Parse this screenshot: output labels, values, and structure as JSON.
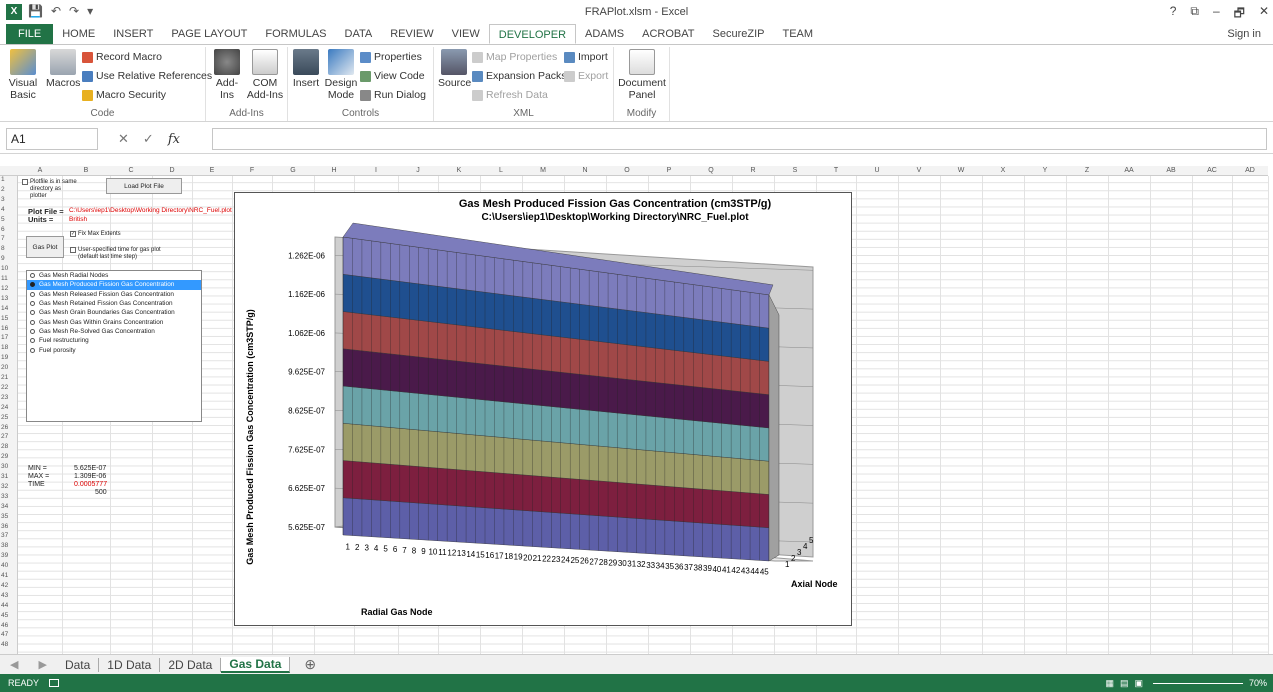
{
  "window": {
    "title": "FRAPlot.xlsm - Excel",
    "app_icon": "excel-icon",
    "controls": [
      "?",
      "⧉",
      "–",
      "🗗",
      "✕"
    ]
  },
  "ribbon_tabs": [
    "FILE",
    "HOME",
    "INSERT",
    "PAGE LAYOUT",
    "FORMULAS",
    "DATA",
    "REVIEW",
    "VIEW",
    "DEVELOPER",
    "ADAMS",
    "ACROBAT",
    "SecureZIP",
    "TEAM"
  ],
  "active_tab": "DEVELOPER",
  "sign_in": "Sign in",
  "ribbon": {
    "code": {
      "label": "Code",
      "visual_basic": "Visual Basic",
      "macros": "Macros",
      "record_macro": "Record Macro",
      "relative_refs": "Use Relative References",
      "macro_security": "Macro Security"
    },
    "addins": {
      "label": "Add-Ins",
      "addins": "Add-Ins",
      "com_addins": "COM Add-Ins"
    },
    "controls": {
      "label": "Controls",
      "insert": "Insert",
      "design_mode": "Design Mode",
      "properties": "Properties",
      "view_code": "View Code",
      "run_dialog": "Run Dialog"
    },
    "xml": {
      "label": "XML",
      "source": "Source",
      "map_properties": "Map Properties",
      "expansion_packs": "Expansion Packs",
      "refresh_data": "Refresh Data",
      "import": "Import",
      "export": "Export"
    },
    "modify": {
      "label": "Modify",
      "document_panel": "Document Panel"
    }
  },
  "namebox": "A1",
  "fx": "fx",
  "columns": [
    "A",
    "B",
    "C",
    "D",
    "E",
    "F",
    "G",
    "H",
    "I",
    "J",
    "K",
    "L",
    "M",
    "N",
    "O",
    "P",
    "Q",
    "R",
    "S",
    "T",
    "U",
    "V",
    "W",
    "X",
    "Y",
    "Z",
    "AA",
    "AB",
    "AC",
    "AD"
  ],
  "sheet": {
    "plotfile_checkbox": "Plotfile is in same directory as plotter",
    "load_button": "Load Plot File",
    "plot_file_label": "Plot File =",
    "plot_file_value": "C:\\Users\\iep1\\Desktop\\Working Directory\\NRC_Fuel.plot",
    "units_label": "Units =",
    "units_value": "British",
    "gas_plot_button": "Gas Plot",
    "fix_max_extents": "Fix Max Extents",
    "user_time": "User-specified time for gas plot (default last time step)",
    "options": [
      "Gas Mesh Radial Nodes",
      "Gas Mesh Produced Fission Gas Concentration",
      "Gas Mesh Released Fission Gas Concentration",
      "Gas Mesh Retained Fission Gas Concentration",
      "Gas Mesh Grain Boundaries Gas Concentration",
      "Gas Mesh Gas Within Grains Concentration",
      "Gas Mesh Re-Solved Gas Concentration",
      "Fuel restructuring",
      "Fuel porosity"
    ],
    "selected_option": 1,
    "min_label": "MIN =",
    "min_value": "5.625E-07",
    "max_label": "MAX =",
    "max_value": "1.309E-06",
    "time_label": "TIME",
    "time_value": "0.0005777",
    "row33_value": "500"
  },
  "chart_data": {
    "type": "surface",
    "title": "Gas Mesh Produced Fission Gas Concentration (cm3STP/g)",
    "subtitle": "C:\\Users\\iep1\\Desktop\\Working Directory\\NRC_Fuel.plot",
    "zlabel": "Gas Mesh Produced Fission Gas Concentration (cm3STP/g)",
    "xlabel": "Radial Gas Node",
    "ylabel": "Axial Node",
    "z_ticks": [
      "5.625E-07",
      "6.625E-07",
      "7.625E-07",
      "8.625E-07",
      "9.625E-07",
      "1.062E-06",
      "1.162E-06",
      "1.262E-06"
    ],
    "z_range": [
      5.625e-07,
      1.309e-06
    ],
    "x_ticks": [
      "1",
      "2",
      "3",
      "4",
      "5",
      "6",
      "7",
      "8",
      "9",
      "10",
      "11",
      "12",
      "13",
      "14",
      "15",
      "16",
      "17",
      "18",
      "19",
      "20",
      "21",
      "22",
      "23",
      "24",
      "25",
      "26",
      "27",
      "28",
      "29",
      "30",
      "31",
      "32",
      "33",
      "34",
      "35",
      "36",
      "37",
      "38",
      "39",
      "40",
      "41",
      "42",
      "43",
      "44",
      "45"
    ],
    "y_ticks": [
      "1",
      "2",
      "3",
      "4",
      "5"
    ],
    "band_colors": [
      "#5d5fa8",
      "#7d1f3f",
      "#9b9b68",
      "#6aa3a8",
      "#4a1a4a",
      "#a04848",
      "#1f4f8f",
      "#7c7cbc"
    ]
  },
  "sheet_tabs": [
    "Data",
    "1D Data",
    "2D Data",
    "Gas Data"
  ],
  "active_sheet": "Gas Data",
  "status": {
    "ready": "READY",
    "zoom": "70%"
  }
}
